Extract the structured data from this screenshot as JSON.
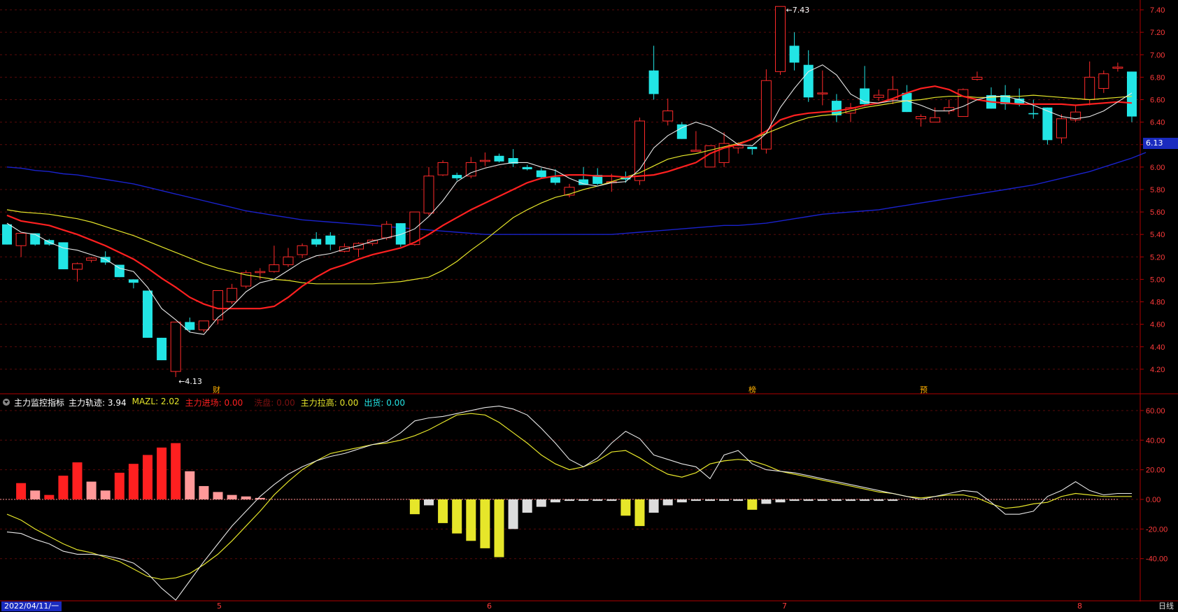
{
  "colors": {
    "bg": "#000000",
    "grid": "#5a0a0a",
    "axis": "#b00000",
    "up": "#ff2a2a",
    "down": "#22e5e5",
    "ma5": "#e8e8e8",
    "ma10": "#ff2020",
    "ma20": "#e6e62a",
    "ma60": "#1a22cc",
    "hist_red": "#ff2020",
    "hist_pink": "#ff9999",
    "hist_yellow": "#e6e62a",
    "hist_white": "#dcdcdc"
  },
  "chart_data": [
    {
      "type": "candlestick",
      "ylim": [
        4.0,
        7.45
      ],
      "yticks": [
        "7.40",
        "7.20",
        "7.00",
        "6.80",
        "6.60",
        "6.40",
        "6.20",
        "6.00",
        "5.80",
        "5.60",
        "5.40",
        "5.20",
        "5.00",
        "4.80",
        "4.60",
        "4.40",
        "4.20"
      ],
      "current_price": "6.13",
      "annotations": {
        "low": "4.13",
        "high": "7.43"
      },
      "markers": [
        "财",
        "榜",
        "预"
      ],
      "candles": [
        [
          5.49,
          5.31,
          5.31,
          5.49
        ],
        [
          5.3,
          5.41,
          5.2,
          5.41
        ],
        [
          5.41,
          5.31,
          5.3,
          5.41
        ],
        [
          5.35,
          5.31,
          5.3,
          5.36
        ],
        [
          5.33,
          5.09,
          5.09,
          5.33
        ],
        [
          5.09,
          5.14,
          4.98,
          5.15
        ],
        [
          5.17,
          5.19,
          5.15,
          5.2
        ],
        [
          5.2,
          5.15,
          5.13,
          5.25
        ],
        [
          5.13,
          5.02,
          5.02,
          5.13
        ],
        [
          5.0,
          4.97,
          4.92,
          5.0
        ],
        [
          4.9,
          4.48,
          4.48,
          4.9
        ],
        [
          4.48,
          4.28,
          4.28,
          4.48
        ],
        [
          4.18,
          4.62,
          4.13,
          4.62
        ],
        [
          4.62,
          4.55,
          4.53,
          4.66
        ],
        [
          4.55,
          4.63,
          4.53,
          4.63
        ],
        [
          4.64,
          4.9,
          4.6,
          4.9
        ],
        [
          4.8,
          4.92,
          4.78,
          4.96
        ],
        [
          4.94,
          5.06,
          4.92,
          5.08
        ],
        [
          5.06,
          5.07,
          5.0,
          5.1
        ],
        [
          5.07,
          5.13,
          5.06,
          5.3
        ],
        [
          5.13,
          5.2,
          5.11,
          5.28
        ],
        [
          5.22,
          5.3,
          5.19,
          5.32
        ],
        [
          5.36,
          5.31,
          5.29,
          5.42
        ],
        [
          5.39,
          5.31,
          5.26,
          5.42
        ],
        [
          5.25,
          5.29,
          5.24,
          5.32
        ],
        [
          5.27,
          5.32,
          5.2,
          5.33
        ],
        [
          5.32,
          5.35,
          5.3,
          5.36
        ],
        [
          5.37,
          5.49,
          5.35,
          5.52
        ],
        [
          5.5,
          5.31,
          5.29,
          5.5
        ],
        [
          5.31,
          5.6,
          5.3,
          5.6
        ],
        [
          5.59,
          5.92,
          5.57,
          6.0
        ],
        [
          5.93,
          6.04,
          5.92,
          6.06
        ],
        [
          5.93,
          5.9,
          5.88,
          5.95
        ],
        [
          5.92,
          6.04,
          5.9,
          6.09
        ],
        [
          6.05,
          6.06,
          6.01,
          6.13
        ],
        [
          6.1,
          6.05,
          6.04,
          6.12
        ],
        [
          6.08,
          6.03,
          6.0,
          6.16
        ],
        [
          6.0,
          5.98,
          5.97,
          6.02
        ],
        [
          5.97,
          5.91,
          5.9,
          5.99
        ],
        [
          5.91,
          5.86,
          5.84,
          5.98
        ],
        [
          5.75,
          5.82,
          5.73,
          5.85
        ],
        [
          5.89,
          5.84,
          5.84,
          6.0
        ],
        [
          5.93,
          5.85,
          5.84,
          5.99
        ],
        [
          5.87,
          5.87,
          5.78,
          5.94
        ],
        [
          5.91,
          5.89,
          5.86,
          5.96
        ],
        [
          5.88,
          6.41,
          5.84,
          6.44
        ],
        [
          6.86,
          6.65,
          6.6,
          7.08
        ],
        [
          6.41,
          6.5,
          6.37,
          6.61
        ],
        [
          6.38,
          6.25,
          6.25,
          6.4
        ],
        [
          6.14,
          6.15,
          6.14,
          6.32
        ],
        [
          6.0,
          6.19,
          6.0,
          6.19
        ],
        [
          6.04,
          6.21,
          6.0,
          6.31
        ],
        [
          6.17,
          6.19,
          6.12,
          6.22
        ],
        [
          6.18,
          6.16,
          6.11,
          6.17
        ],
        [
          6.16,
          6.77,
          6.12,
          6.87
        ],
        [
          6.85,
          7.43,
          6.82,
          7.43
        ],
        [
          7.08,
          6.93,
          6.86,
          7.2
        ],
        [
          6.91,
          6.62,
          6.58,
          7.04
        ],
        [
          6.66,
          6.66,
          6.55,
          6.86
        ],
        [
          6.59,
          6.46,
          6.4,
          6.65
        ],
        [
          6.48,
          6.53,
          6.4,
          6.57
        ],
        [
          6.7,
          6.56,
          6.54,
          6.9
        ],
        [
          6.62,
          6.64,
          6.59,
          6.69
        ],
        [
          6.6,
          6.69,
          6.56,
          6.81
        ],
        [
          6.66,
          6.49,
          6.49,
          6.73
        ],
        [
          6.43,
          6.45,
          6.36,
          6.47
        ],
        [
          6.4,
          6.44,
          6.4,
          6.53
        ],
        [
          6.5,
          6.53,
          6.47,
          6.6
        ],
        [
          6.45,
          6.69,
          6.45,
          6.7
        ],
        [
          6.78,
          6.8,
          6.77,
          6.85
        ],
        [
          6.64,
          6.52,
          6.52,
          6.71
        ],
        [
          6.64,
          6.56,
          6.51,
          6.73
        ],
        [
          6.61,
          6.56,
          6.54,
          6.7
        ],
        [
          6.48,
          6.47,
          6.43,
          6.6
        ],
        [
          6.53,
          6.24,
          6.2,
          6.53
        ],
        [
          6.26,
          6.43,
          6.21,
          6.47
        ],
        [
          6.42,
          6.49,
          6.4,
          6.55
        ],
        [
          6.6,
          6.8,
          6.55,
          6.94
        ],
        [
          6.7,
          6.83,
          6.66,
          6.86
        ],
        [
          6.88,
          6.89,
          6.85,
          6.93
        ],
        [
          6.85,
          6.45,
          6.4,
          6.85
        ]
      ],
      "ma5": [
        5.5,
        5.42,
        5.4,
        5.33,
        5.28,
        5.26,
        5.22,
        5.18,
        5.1,
        5.07,
        4.93,
        4.74,
        4.64,
        4.53,
        4.51,
        4.66,
        4.76,
        4.89,
        4.97,
        5.0,
        5.08,
        5.16,
        5.21,
        5.23,
        5.27,
        5.3,
        5.34,
        5.37,
        5.4,
        5.45,
        5.56,
        5.7,
        5.87,
        5.95,
        5.99,
        6.02,
        6.04,
        6.04,
        6.0,
        5.97,
        5.9,
        5.85,
        5.83,
        5.86,
        5.87,
        5.98,
        6.17,
        6.28,
        6.35,
        6.4,
        6.36,
        6.29,
        6.2,
        6.19,
        6.3,
        6.53,
        6.7,
        6.85,
        6.91,
        6.82,
        6.65,
        6.58,
        6.57,
        6.59,
        6.59,
        6.55,
        6.5,
        6.5,
        6.54,
        6.6,
        6.63,
        6.63,
        6.6,
        6.55,
        6.5,
        6.45,
        6.43,
        6.45,
        6.5,
        6.58,
        6.66
      ],
      "ma10": [
        5.57,
        5.52,
        5.5,
        5.48,
        5.44,
        5.4,
        5.35,
        5.3,
        5.24,
        5.18,
        5.1,
        5.01,
        4.93,
        4.84,
        4.78,
        4.74,
        4.74,
        4.74,
        4.74,
        4.76,
        4.84,
        4.94,
        5.02,
        5.09,
        5.13,
        5.18,
        5.22,
        5.25,
        5.28,
        5.33,
        5.4,
        5.48,
        5.55,
        5.62,
        5.68,
        5.74,
        5.8,
        5.86,
        5.9,
        5.92,
        5.93,
        5.93,
        5.92,
        5.92,
        5.91,
        5.92,
        5.93,
        5.96,
        6.0,
        6.04,
        6.12,
        6.17,
        6.2,
        6.25,
        6.32,
        6.42,
        6.46,
        6.48,
        6.49,
        6.5,
        6.52,
        6.55,
        6.57,
        6.61,
        6.66,
        6.7,
        6.72,
        6.69,
        6.63,
        6.6,
        6.58,
        6.57,
        6.56,
        6.56,
        6.56,
        6.56,
        6.55,
        6.56,
        6.57,
        6.58,
        6.57
      ],
      "ma20": [
        5.62,
        5.6,
        5.59,
        5.58,
        5.56,
        5.54,
        5.51,
        5.47,
        5.43,
        5.39,
        5.34,
        5.29,
        5.24,
        5.19,
        5.14,
        5.1,
        5.07,
        5.04,
        5.02,
        5.0,
        4.99,
        4.97,
        4.96,
        4.96,
        4.96,
        4.96,
        4.96,
        4.97,
        4.98,
        5.0,
        5.02,
        5.08,
        5.16,
        5.26,
        5.35,
        5.45,
        5.55,
        5.62,
        5.68,
        5.73,
        5.76,
        5.8,
        5.83,
        5.87,
        5.91,
        5.95,
        6.01,
        6.07,
        6.1,
        6.12,
        6.15,
        6.18,
        6.21,
        6.25,
        6.3,
        6.35,
        6.4,
        6.44,
        6.46,
        6.47,
        6.5,
        6.53,
        6.55,
        6.57,
        6.59,
        6.6,
        6.62,
        6.63,
        6.63,
        6.62,
        6.62,
        6.63,
        6.63,
        6.64,
        6.63,
        6.62,
        6.61,
        6.6,
        6.61,
        6.62,
        6.63
      ],
      "ma60": [
        6.0,
        5.99,
        5.97,
        5.96,
        5.94,
        5.93,
        5.91,
        5.89,
        5.87,
        5.85,
        5.82,
        5.79,
        5.76,
        5.73,
        5.7,
        5.67,
        5.64,
        5.61,
        5.59,
        5.57,
        5.55,
        5.53,
        5.52,
        5.51,
        5.5,
        5.49,
        5.48,
        5.47,
        5.46,
        5.45,
        5.44,
        5.43,
        5.42,
        5.41,
        5.4,
        5.4,
        5.4,
        5.4,
        5.4,
        5.4,
        5.4,
        5.4,
        5.4,
        5.4,
        5.41,
        5.42,
        5.43,
        5.44,
        5.45,
        5.46,
        5.47,
        5.48,
        5.48,
        5.49,
        5.5,
        5.52,
        5.54,
        5.56,
        5.58,
        5.59,
        5.6,
        5.61,
        5.62,
        5.64,
        5.66,
        5.68,
        5.7,
        5.72,
        5.74,
        5.76,
        5.78,
        5.8,
        5.82,
        5.84,
        5.87,
        5.9,
        5.93,
        5.96,
        6.0,
        6.04,
        6.08,
        6.13
      ]
    },
    {
      "type": "bar+line",
      "ylim": [
        -68,
        68
      ],
      "yticks": [
        "60.00",
        "40.00",
        "20.00",
        "0.00",
        "-20.00",
        "-40.00"
      ],
      "indicator": {
        "name": "主力监控指标",
        "items": [
          {
            "label": "主力轨迹: 3.94",
            "color": "#ffffff"
          },
          {
            "label": "MAZL: 2.02",
            "color": "#e6e62a"
          },
          {
            "label": "主力进场: 0.00",
            "color": "#ff2020"
          },
          {
            "label": "洗盘: 0.00",
            "color": "#7a1010"
          },
          {
            "label": "主力拉高: 0.00",
            "color": "#e6e62a"
          },
          {
            "label": "出货: 0.00",
            "color": "#22e5e5"
          }
        ]
      },
      "histogram": [
        0,
        11,
        6,
        3,
        16,
        25,
        12,
        6,
        18,
        24,
        30,
        35,
        38,
        19,
        9,
        5,
        3,
        2,
        1,
        0,
        0,
        0,
        0,
        0,
        0,
        0,
        0,
        0,
        0,
        -10,
        -4,
        -16,
        -23,
        -28,
        -33,
        -39,
        -20,
        -9,
        -5,
        -2,
        -1,
        -1,
        -1,
        -1,
        -11,
        -18,
        -9,
        -4,
        -2,
        -1,
        -1,
        -1,
        -1,
        -7,
        -3,
        -2,
        -1,
        -1,
        -1,
        -1,
        -1,
        -1,
        -1,
        -1,
        0,
        0,
        0,
        0,
        0,
        0,
        0,
        0,
        0,
        0,
        0,
        0,
        0,
        0,
        0,
        0
      ],
      "histogram_colors": [
        "r",
        "r",
        "p",
        "r",
        "r",
        "r",
        "p",
        "p",
        "r",
        "r",
        "r",
        "r",
        "r",
        "p",
        "p",
        "p",
        "p",
        "p",
        "p",
        "p",
        "p",
        "p",
        "p",
        "p",
        "p",
        "p",
        "p",
        "p",
        "p",
        "y",
        "w",
        "y",
        "y",
        "y",
        "y",
        "y",
        "w",
        "w",
        "w",
        "w",
        "w",
        "w",
        "w",
        "w",
        "y",
        "y",
        "w",
        "w",
        "w",
        "w",
        "w",
        "w",
        "w",
        "y",
        "w",
        "w",
        "w",
        "w",
        "w",
        "w",
        "w",
        "w",
        "w",
        "w",
        "w",
        "w",
        "w",
        "w",
        "w",
        "w",
        "w",
        "w",
        "w",
        "w",
        "w",
        "w",
        "w",
        "w",
        "w",
        "w",
        "w"
      ],
      "line1": [
        -22,
        -23,
        -27,
        -30,
        -35,
        -37,
        -37,
        -38,
        -40,
        -43,
        -50,
        -60,
        -68,
        -55,
        -42,
        -30,
        -18,
        -8,
        2,
        10,
        17,
        22,
        26,
        29,
        31,
        34,
        37,
        39,
        45,
        53,
        55,
        56,
        58,
        60,
        62,
        63,
        61,
        57,
        48,
        38,
        27,
        22,
        28,
        38,
        46,
        41,
        30,
        27,
        24,
        22,
        14,
        30,
        33,
        24,
        20,
        19,
        18,
        16,
        14,
        12,
        10,
        8,
        6,
        4,
        2,
        0,
        2,
        4,
        6,
        5,
        -2,
        -10,
        -10,
        -8,
        2,
        6,
        12,
        6,
        3,
        4,
        4
      ],
      "line2": [
        -10,
        -14,
        -20,
        -25,
        -30,
        -34,
        -36,
        -39,
        -42,
        -47,
        -52,
        -54,
        -53,
        -50,
        -44,
        -37,
        -28,
        -18,
        -8,
        3,
        12,
        20,
        26,
        31,
        33,
        35,
        37,
        38,
        40,
        43,
        47,
        52,
        57,
        58,
        57,
        52,
        45,
        38,
        30,
        24,
        20,
        22,
        26,
        32,
        33,
        28,
        22,
        17,
        15,
        18,
        24,
        26,
        27,
        26,
        23,
        19,
        17,
        15,
        13,
        11,
        9,
        7,
        5,
        4,
        2,
        1,
        2,
        3,
        3,
        1,
        -3,
        -6,
        -5,
        -3,
        -2,
        2,
        4,
        3,
        2,
        2,
        2
      ]
    }
  ],
  "bottom": {
    "start_date": "2022/04/11/一",
    "months": [
      "5",
      "6",
      "7",
      "8"
    ],
    "period": "日线"
  }
}
